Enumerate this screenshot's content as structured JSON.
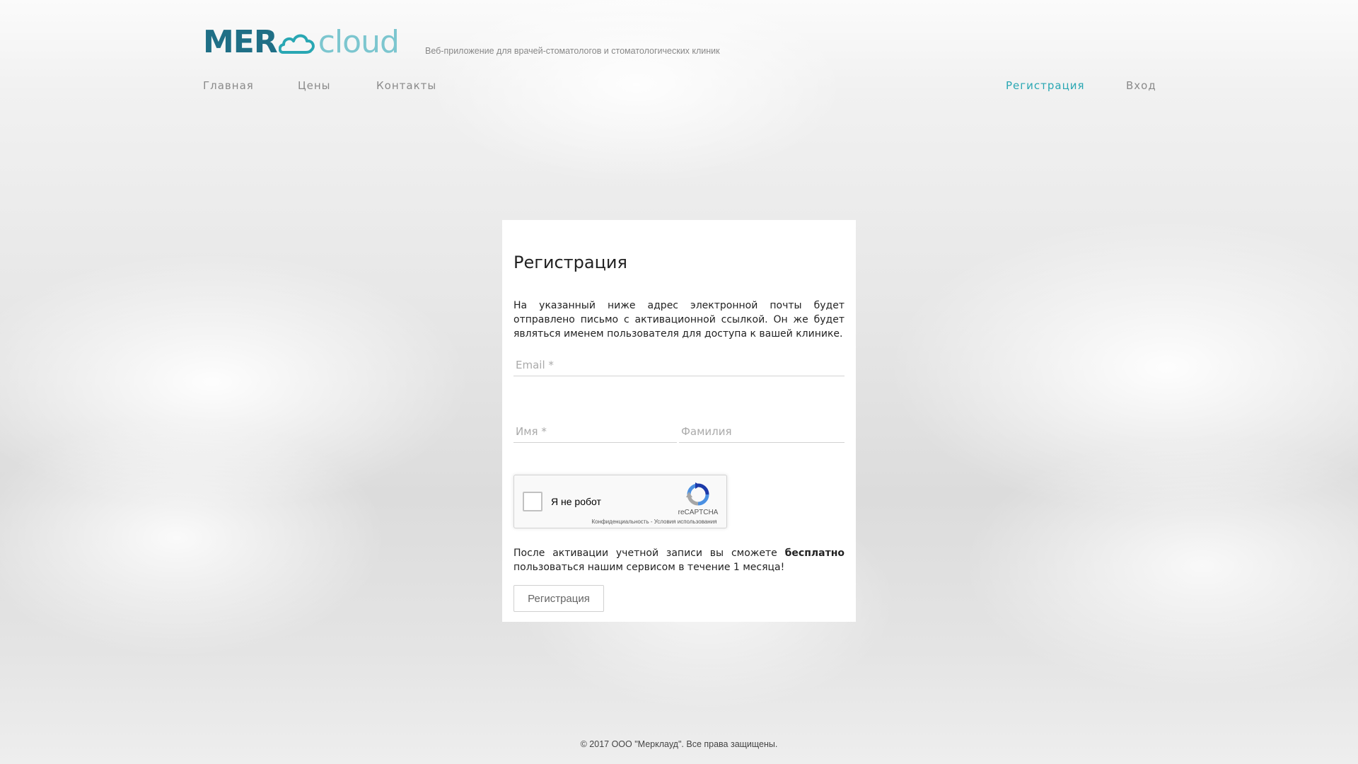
{
  "header": {
    "logo_part1": "MER",
    "logo_part2": "cloud",
    "tagline": "Веб-приложение для врачей-стоматологов и стоматологических клиник"
  },
  "nav": {
    "home": "Главная",
    "prices": "Цены",
    "contacts": "Контакты",
    "register": "Регистрация",
    "login": "Вход"
  },
  "form": {
    "title": "Регистрация",
    "intro": "На указанный ниже адрес электронной почты будет отправлено письмо с активационной ссылкой. Он же будет являться именем пользователя для доступа к вашей клинике.",
    "email": {
      "placeholder": "Email *",
      "value": ""
    },
    "first_name": {
      "placeholder": "Имя *",
      "value": ""
    },
    "last_name": {
      "placeholder": "Фамилия",
      "value": ""
    },
    "recaptcha": {
      "label": "Я не робот",
      "brand": "reCAPTCHA",
      "terms": "Конфиденциальность - Условия использования"
    },
    "note_before": "После активации учетной записи вы сможете ",
    "note_bold": "бесплатно",
    "note_after": " пользоваться нашим сервисом в течение 1 месяца!",
    "submit_label": "Регистрация"
  },
  "footer": {
    "copyright": "© 2017 ООО \"Мерклауд\". Все права защищены."
  },
  "colors": {
    "accent": "#29a7b3",
    "logo_dark": "#1f6f86",
    "logo_light": "#7cc6cf"
  }
}
